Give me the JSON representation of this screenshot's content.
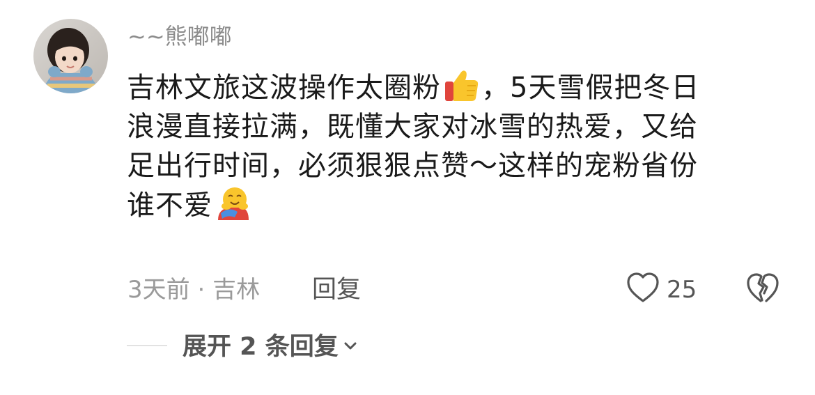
{
  "comment": {
    "username": "~~熊嘟嘟",
    "text_line1_part1": "吉林文旅这波操作太圈粉",
    "text_line1_part2": "，5天雪假把冬日",
    "text_line2": "浪漫直接拉满，既懂大家对冰雪的热爱，又给",
    "text_line3": "足出行时间，必须狠狠点赞～这样的宠粉省份",
    "text_line4": "谁不爱",
    "emoji_1": "thumbs-up-icon",
    "emoji_2": "hugging-face-icon",
    "time": "3天前",
    "separator": "·",
    "location": "吉林",
    "reply_label": "回复",
    "like_count": "25",
    "expand_label": "展开 2 条回复"
  },
  "colors": {
    "username": "#8c8c8c",
    "text": "#1a1a1a",
    "meta": "#9a9a9a",
    "action": "#555555"
  }
}
